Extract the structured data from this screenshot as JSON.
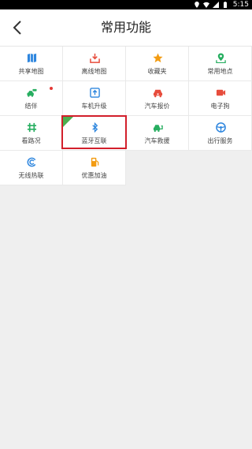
{
  "status_bar": {
    "time": "5:15"
  },
  "header": {
    "title": "常用功能",
    "back_icon": "chevron-left-icon"
  },
  "grid": [
    {
      "label": "共享地图",
      "icon": "map-icon",
      "color": "#2e86de"
    },
    {
      "label": "离线地图",
      "icon": "download-icon",
      "color": "#e74c3c"
    },
    {
      "label": "收藏夹",
      "icon": "star-icon",
      "color": "#f39c12"
    },
    {
      "label": "常用地点",
      "icon": "location-icon",
      "color": "#27ae60"
    },
    {
      "label": "结伴",
      "icon": "car-group-icon",
      "color": "#27ae60"
    },
    {
      "label": "车机升级",
      "icon": "upload-icon",
      "color": "#2e86de"
    },
    {
      "label": "汽车报价",
      "icon": "car-price-icon",
      "color": "#e74c3c"
    },
    {
      "label": "电子狗",
      "icon": "camera-icon",
      "color": "#e74c3c"
    },
    {
      "label": "看路况",
      "icon": "traffic-icon",
      "color": "#27ae60"
    },
    {
      "label": "蓝牙互联",
      "icon": "bluetooth-icon",
      "color": "#2e86de"
    },
    {
      "label": "汽车救援",
      "icon": "car-rescue-icon",
      "color": "#27ae60"
    },
    {
      "label": "出行服务",
      "icon": "steering-wheel-icon",
      "color": "#2e86de"
    },
    {
      "label": "无线热联",
      "icon": "wireless-link-icon",
      "color": "#2e86de"
    },
    {
      "label": "优惠加油",
      "icon": "fuel-icon",
      "color": "#f39c12"
    }
  ]
}
